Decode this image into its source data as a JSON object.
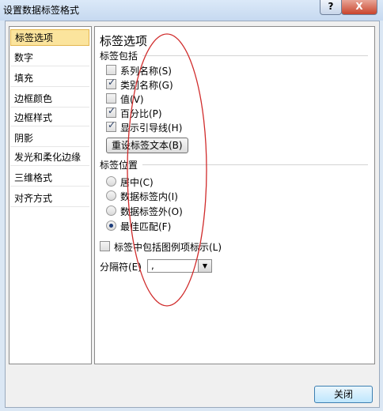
{
  "window": {
    "title": "设置数据标签格式",
    "help_button": "?",
    "close_glyph": "X"
  },
  "nav": {
    "items": [
      "标签选项",
      "数字",
      "填充",
      "边框颜色",
      "边框样式",
      "阴影",
      "发光和柔化边缘",
      "三维格式",
      "对齐方式"
    ],
    "selected": 0
  },
  "panel": {
    "title": "标签选项",
    "contains": {
      "label": "标签包括",
      "options": [
        {
          "label": "系列名称(S)",
          "checked": false
        },
        {
          "label": "类别名称(G)",
          "checked": true
        },
        {
          "label": "值(V)",
          "checked": false
        },
        {
          "label": "百分比(P)",
          "checked": true
        },
        {
          "label": "显示引导线(H)",
          "checked": true
        }
      ],
      "reset_button": "重设标签文本(B)"
    },
    "position": {
      "label": "标签位置",
      "options": [
        {
          "label": "居中(C)",
          "selected": false
        },
        {
          "label": "数据标签内(I)",
          "selected": false
        },
        {
          "label": "数据标签外(O)",
          "selected": false
        },
        {
          "label": "最佳匹配(F)",
          "selected": true
        }
      ]
    },
    "legend_key": {
      "label": "标签中包括图例项标示(L)",
      "checked": false
    },
    "separator": {
      "label": "分隔符(E)",
      "value": ","
    }
  },
  "footer": {
    "close_button": "关闭"
  },
  "colors": {
    "annotation": "#d02b2b",
    "selection_fill": "#fbe49d"
  }
}
